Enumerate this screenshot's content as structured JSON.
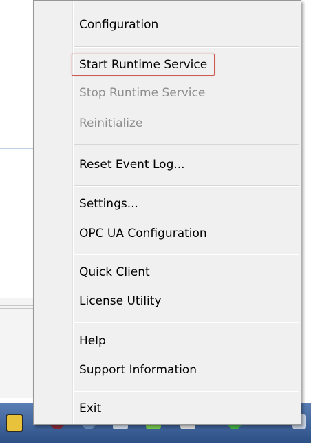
{
  "menu": {
    "items": [
      {
        "label": "Configuration",
        "enabled": true
      },
      {
        "label": "Start Runtime Service",
        "enabled": true,
        "highlighted": true
      },
      {
        "label": "Stop Runtime Service",
        "enabled": false
      },
      {
        "label": "Reinitialize",
        "enabled": false
      },
      {
        "label": "Reset Event Log...",
        "enabled": true
      },
      {
        "label": "Settings...",
        "enabled": true
      },
      {
        "label": "OPC UA Configuration",
        "enabled": true
      },
      {
        "label": "Quick Client",
        "enabled": true
      },
      {
        "label": "License Utility",
        "enabled": true
      },
      {
        "label": "Help",
        "enabled": true
      },
      {
        "label": "Support Information",
        "enabled": true
      },
      {
        "label": "Exit",
        "enabled": true
      }
    ]
  },
  "taskbar": {
    "tray_icons": [
      "kepserver-tray-icon",
      "shield-icon",
      "network-icon",
      "volume-icon",
      "signal-icon",
      "flag-icon",
      "update-icon"
    ]
  },
  "colors": {
    "highlight_border": "#cc5a4f",
    "menu_background": "#f0f0f0",
    "taskbar": "#2c4f86"
  }
}
